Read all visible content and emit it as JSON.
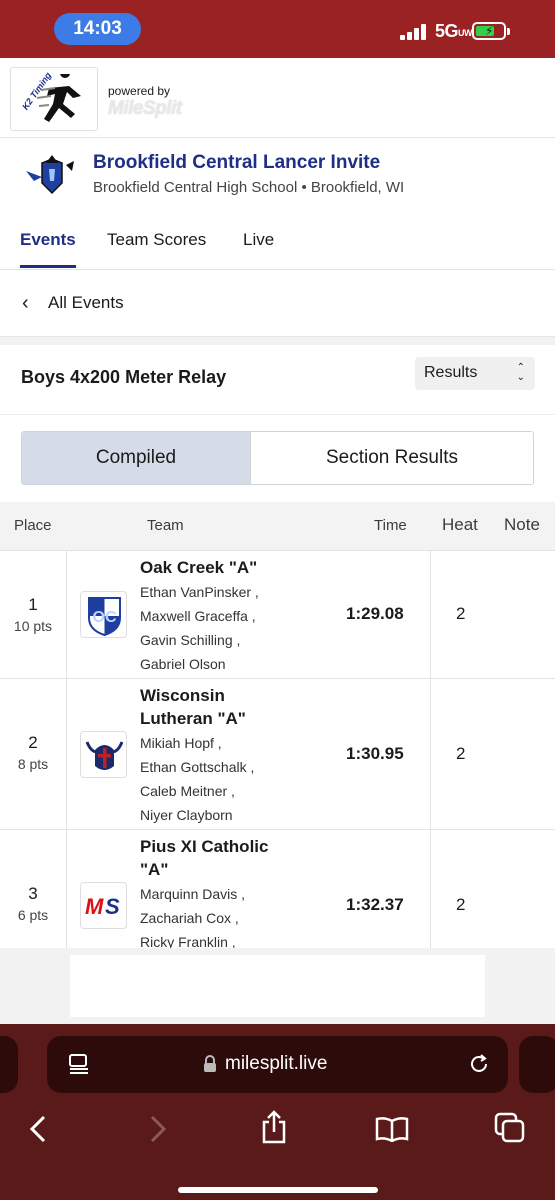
{
  "status": {
    "time": "14:03",
    "network": "5G",
    "network_sup": "UW"
  },
  "branding": {
    "powered_by": "powered by",
    "milesplit": "MileSplit",
    "k2": "K2 Timing"
  },
  "meet": {
    "title": "Brookfield Central Lancer Invite",
    "subtitle": "Brookfield Central High School • Brookfield, WI"
  },
  "tabs": [
    {
      "label": "Events",
      "active": true
    },
    {
      "label": "Team Scores",
      "active": false
    },
    {
      "label": "Live",
      "active": false
    }
  ],
  "back": {
    "label": "All Events"
  },
  "event": {
    "title": "Boys 4x200 Meter Relay",
    "view_select": "Results"
  },
  "segments": {
    "compiled": "Compiled",
    "section": "Section Results",
    "active": "compiled"
  },
  "table": {
    "headers": {
      "place": "Place",
      "team": "Team",
      "time": "Time",
      "heat": "Heat",
      "note": "Note"
    },
    "rows": [
      {
        "place": "1",
        "points": "10 pts",
        "team_lines": [
          "Oak Creek \"A\""
        ],
        "athletes": [
          "Ethan VanPinsker ,",
          "Maxwell Graceffa ,",
          "Gavin Schilling ,",
          "Gabriel Olson"
        ],
        "time": "1:29.08",
        "heat": "2",
        "logo": "oc-shield-icon"
      },
      {
        "place": "2",
        "points": "8 pts",
        "team_lines": [
          "Wisconsin",
          "Lutheran \"A\""
        ],
        "athletes": [
          "Mikiah Hopf ,",
          "Ethan Gottschalk ,",
          "Caleb Meitner ,",
          "Niyer Clayborn"
        ],
        "time": "1:30.95",
        "heat": "2",
        "logo": "viking-helmet-icon"
      },
      {
        "place": "3",
        "points": "6 pts",
        "team_lines": [
          "Pius XI Catholic",
          "\"A\""
        ],
        "athletes": [
          "Marquinn Davis ,",
          "Zachariah Cox ,",
          "Ricky Franklin ,"
        ],
        "time": "1:32.37",
        "heat": "2",
        "logo": "ms-logo-icon"
      }
    ]
  },
  "browser": {
    "url": "milesplit.live"
  },
  "colors": {
    "status_bar": "#9b2222",
    "brand_navy": "#1f2e86",
    "browser_bg": "#5a1a1a",
    "url_bar": "#2e0b0b",
    "segment_active": "#d6dbe8"
  }
}
